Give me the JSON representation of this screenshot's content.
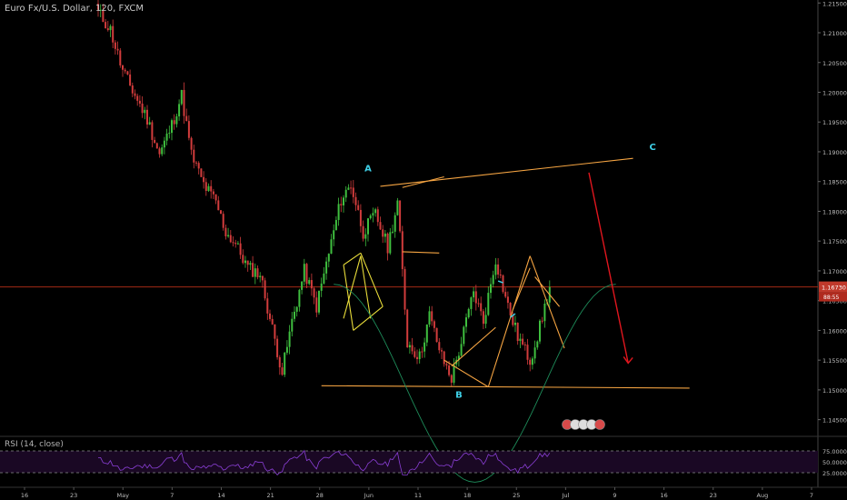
{
  "header": {
    "title": "Euro Fx/U.S. Dollar, 120, FXCM"
  },
  "rsi_panel": {
    "title": "RSI (14, close)"
  },
  "colors": {
    "background": "#000000",
    "candle_up": "#3fbf3f",
    "candle_down": "#d23c3c",
    "pattern_orange": "#f5a442",
    "pattern_yellow": "#e8dc3a",
    "arc_green": "#1e8c5a",
    "letter_cyan": "#3fd1e8",
    "projection_red": "#e0161e",
    "current_line": "#a32a14",
    "price_tag_bg": "#c0392b",
    "rsi_line": "#8a3fd6",
    "rsi_band": "#1a0824"
  },
  "chart_data": {
    "type": "candlestick",
    "title": "Euro Fx/U.S. Dollar, 120, FXCM",
    "ylim": [
      1.1425,
      1.2155
    ],
    "price_ticks": [
      1.215,
      1.21,
      1.205,
      1.2,
      1.195,
      1.19,
      1.185,
      1.18,
      1.175,
      1.17,
      1.165,
      1.16,
      1.155,
      1.15,
      1.145
    ],
    "price_tick_labels": [
      "1.21500",
      "1.21000",
      "1.20500",
      "1.20000",
      "1.19500",
      "1.19000",
      "1.18500",
      "1.18000",
      "1.17500",
      "1.17000",
      "1.16500",
      "1.16000",
      "1.15500",
      "1.15000",
      "1.14500"
    ],
    "current_price": 1.1673,
    "current_price_label": "1.16730",
    "countdown_label": "88:55",
    "time_ticks": [
      "16",
      "23",
      "May",
      "7",
      "14",
      "21",
      "28",
      "Jun",
      "11",
      "18",
      "25",
      "Jul",
      "9",
      "16",
      "23",
      "Aug",
      "7"
    ],
    "price_path": [
      [
        0,
        1.2135
      ],
      [
        5,
        1.2105
      ],
      [
        10,
        1.2035
      ],
      [
        15,
        1.1995
      ],
      [
        20,
        1.1955
      ],
      [
        25,
        1.1895
      ],
      [
        30,
        1.1945
      ],
      [
        34,
        1.1995
      ],
      [
        38,
        1.1895
      ],
      [
        43,
        1.1845
      ],
      [
        48,
        1.1815
      ],
      [
        52,
        1.1765
      ],
      [
        56,
        1.1745
      ],
      [
        61,
        1.1705
      ],
      [
        66,
        1.1695
      ],
      [
        70,
        1.162
      ],
      [
        75,
        1.153
      ],
      [
        79,
        1.1615
      ],
      [
        84,
        1.17
      ],
      [
        89,
        1.164
      ],
      [
        94,
        1.173
      ],
      [
        99,
        1.182
      ],
      [
        103,
        1.1845
      ],
      [
        108,
        1.1765
      ],
      [
        113,
        1.1795
      ],
      [
        118,
        1.174
      ],
      [
        122,
        1.1815
      ],
      [
        126,
        1.158
      ],
      [
        131,
        1.1555
      ],
      [
        135,
        1.1625
      ],
      [
        140,
        1.1555
      ],
      [
        144,
        1.152
      ],
      [
        148,
        1.158
      ],
      [
        153,
        1.1665
      ],
      [
        157,
        1.1615
      ],
      [
        162,
        1.172
      ],
      [
        167,
        1.164
      ],
      [
        171,
        1.159
      ],
      [
        176,
        1.155
      ],
      [
        180,
        1.1605
      ],
      [
        184,
        1.1673
      ]
    ],
    "wave_labels": [
      {
        "text": "A",
        "bar": 110,
        "price": 1.1867
      },
      {
        "text": "B",
        "bar": 147,
        "price": 1.1487
      },
      {
        "text": "C",
        "bar": 226,
        "price": 1.1903
      }
    ],
    "rsi": {
      "levels": [
        75,
        50,
        25
      ],
      "level_labels": [
        "75.0000",
        "50.0000",
        "25.0000"
      ],
      "min": 0,
      "max": 100
    }
  }
}
